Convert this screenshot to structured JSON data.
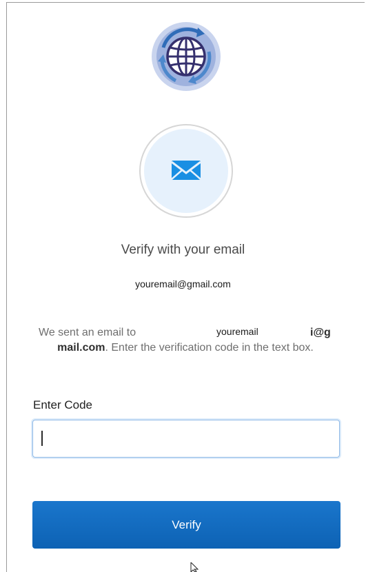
{
  "app": {
    "title": "Verify with your email"
  },
  "identity": {
    "email": "youremail@gmail.com"
  },
  "message": {
    "prefix": "We sent an email to",
    "email_part1": "youremail",
    "email_part2": "i@g",
    "email_part3": "mail.com",
    "suffix": ". Enter the verification code in the text box."
  },
  "form": {
    "code_label": "Enter Code",
    "code_value": "",
    "code_placeholder": "",
    "verify_label": "Verify"
  },
  "icons": {
    "logo": "globe-logo-icon",
    "factor": "mail-icon",
    "pointer": "mouse-pointer-icon"
  },
  "colors": {
    "accent": "#0f67bb",
    "factor_bg": "#e6f1fc",
    "input_focus": "#8fb9e6"
  }
}
